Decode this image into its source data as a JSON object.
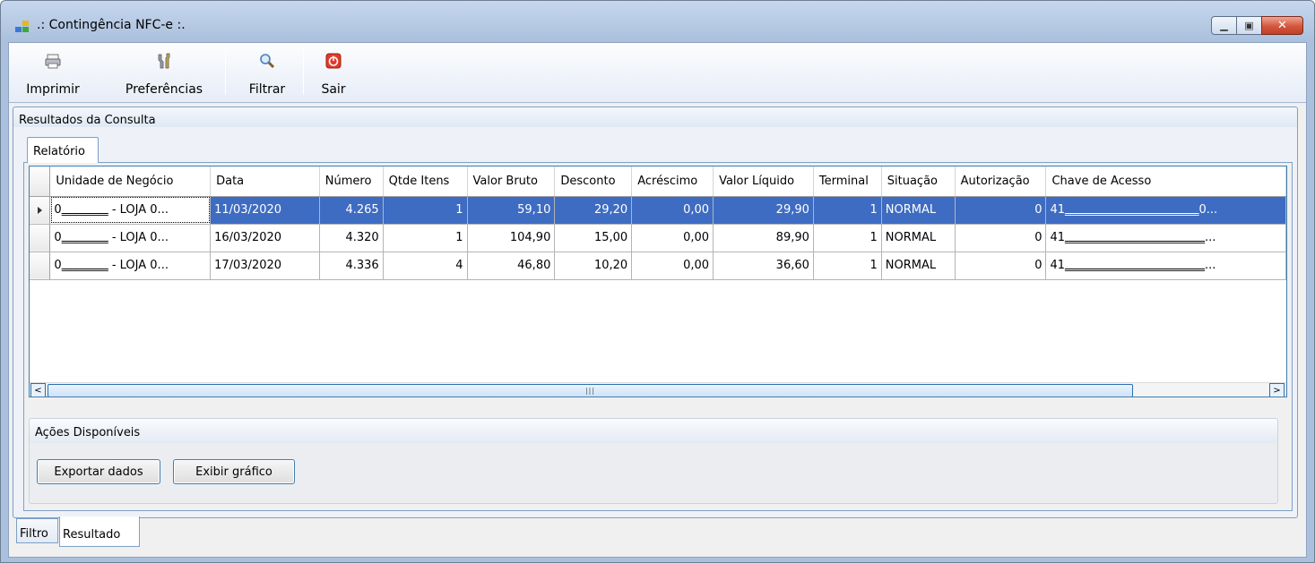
{
  "window": {
    "title": ".: Contingência NFC-e :.",
    "controls": [
      "minimize-icon",
      "maximize-icon",
      "close-icon"
    ]
  },
  "toolbar": {
    "imprimir": "Imprimir",
    "preferencias": "Preferências",
    "filtrar": "Filtrar",
    "sair": "Sair"
  },
  "group": {
    "title": "Resultados da Consulta",
    "tab": "Relatório"
  },
  "grid": {
    "columns": [
      "Unidade de Negócio",
      "Data",
      "Número",
      "Qtde Itens",
      "Valor Bruto",
      "Desconto",
      "Acréscimo",
      "Valor Líquido",
      "Terminal",
      "Situação",
      "Autorização",
      "Chave de Acesso"
    ],
    "rows": [
      [
        "0‗‗‗‗‗‗‗‗ - LOJA 0...",
        "11/03/2020",
        "4.265",
        "1",
        "59,10",
        "29,20",
        "0,00",
        "29,90",
        "1",
        "NORMAL",
        "0",
        "41‗‗‗‗‗‗‗‗‗‗‗‗‗‗‗‗‗‗‗‗‗‗‗0..."
      ],
      [
        "0‗‗‗‗‗‗‗‗ - LOJA 0...",
        "16/03/2020",
        "4.320",
        "1",
        "104,90",
        "15,00",
        "0,00",
        "89,90",
        "1",
        "NORMAL",
        "0",
        "41‗‗‗‗‗‗‗‗‗‗‗‗‗‗‗‗‗‗‗‗‗‗‗‗..."
      ],
      [
        "0‗‗‗‗‗‗‗‗ - LOJA 0...",
        "17/03/2020",
        "4.336",
        "4",
        "46,80",
        "10,20",
        "0,00",
        "36,60",
        "1",
        "NORMAL",
        "0",
        "41‗‗‗‗‗‗‗‗‗‗‗‗‗‗‗‗‗‗‗‗‗‗‗‗..."
      ]
    ],
    "selected_row": 0
  },
  "acoes": {
    "title": "Ações Disponíveis",
    "exportar": "Exportar dados",
    "grafico": "Exibir gráfico"
  },
  "bottom_tabs": {
    "filtro": "Filtro",
    "resultado": "Resultado"
  },
  "colors": {
    "selection": "#3e6cc2",
    "accent_border": "#7ea0c8",
    "close": "#c0402a"
  }
}
